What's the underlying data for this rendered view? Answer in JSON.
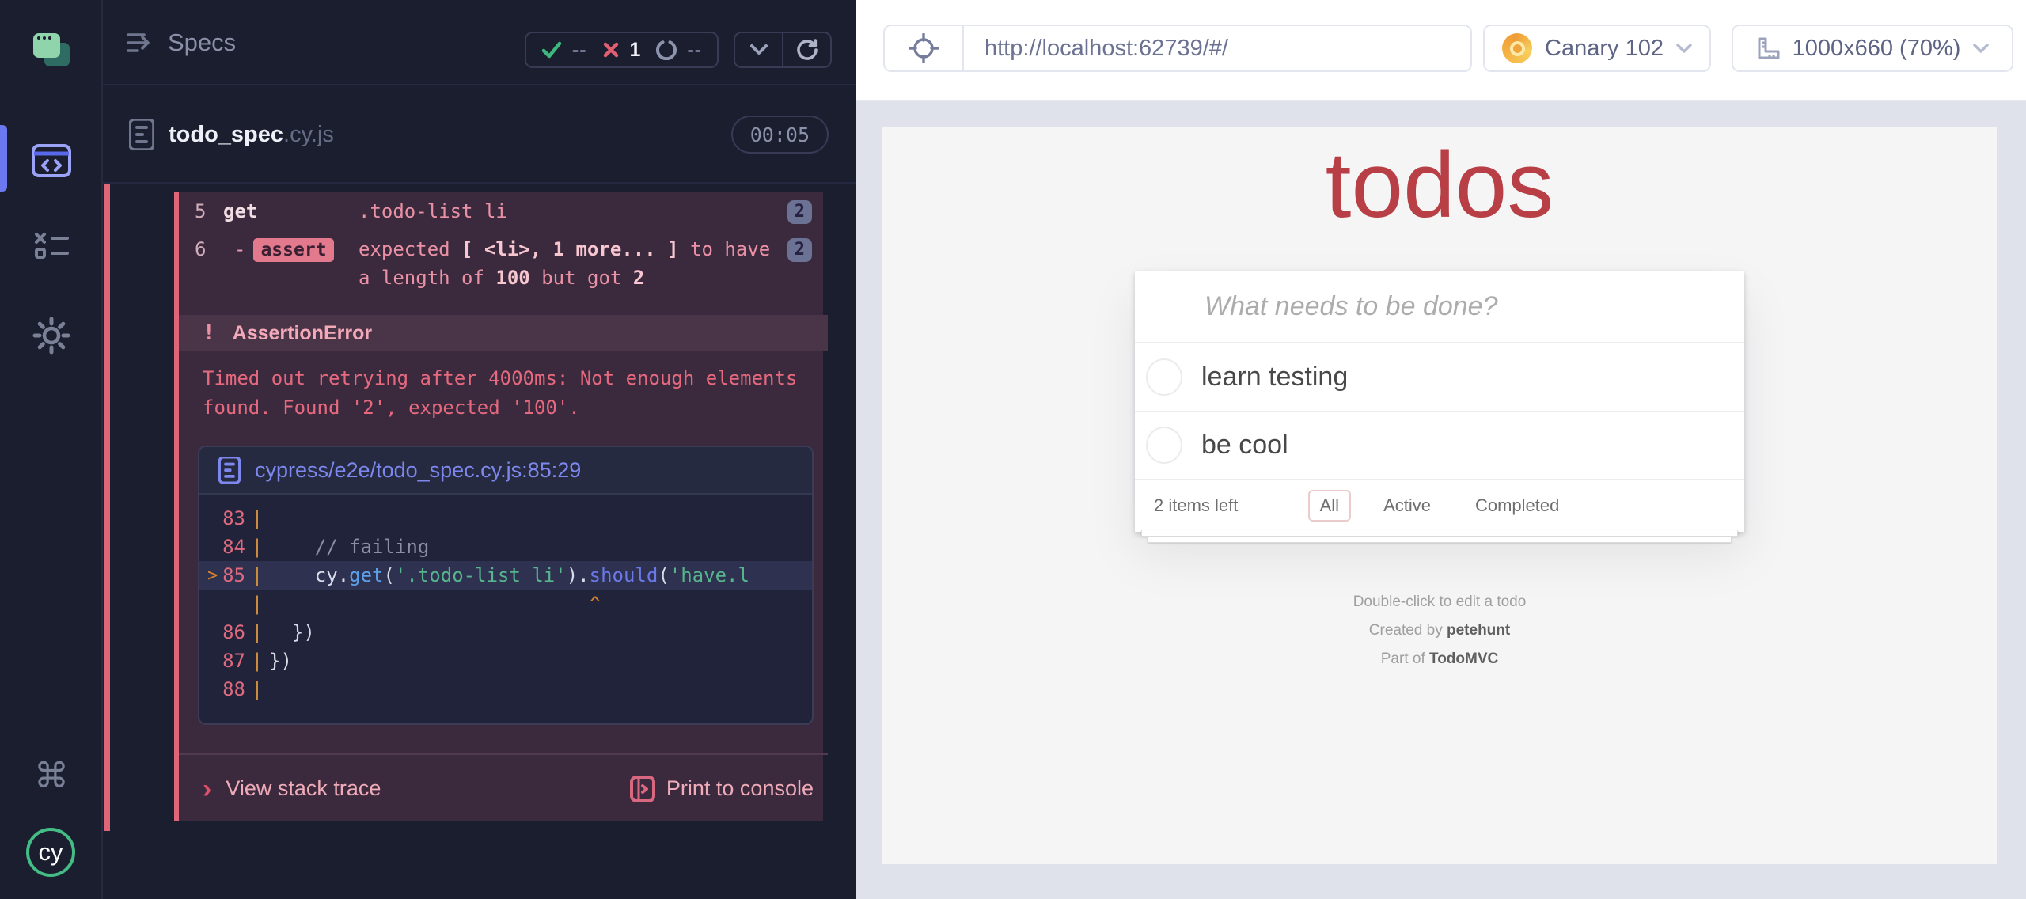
{
  "colors": {
    "accent_failed": "#e16b7f",
    "attempt_bg": "#3b2a3d",
    "panel_bg": "#1b1e2e",
    "pass_green": "#3eb77e",
    "fail_red": "#e25f71",
    "link_blue": "#7d88ef",
    "code_string_green": "#56b58c",
    "code_orange": "#d9832b",
    "canary_orange": "#f2a93f",
    "todo_title_red": "#b83f45",
    "brand_green": "#43bd85"
  },
  "sidebar": {
    "items": [
      {
        "id": "specs",
        "active": true
      },
      {
        "id": "runs",
        "active": false
      },
      {
        "id": "settings",
        "active": false
      }
    ],
    "command_glyph": "⌘",
    "cy_logo": "cy"
  },
  "reporter": {
    "title": "Specs",
    "stats": {
      "passed": "--",
      "failed": "1",
      "pending": "--"
    },
    "spec": {
      "name": "todo_spec",
      "ext": ".cy.js",
      "duration": "00:05"
    },
    "commands": [
      {
        "line": "5",
        "method": "get",
        "badge_method": false,
        "dash": "",
        "msg_lines": [
          [
            {
              "t": ".todo-list li"
            }
          ]
        ],
        "count": "2"
      },
      {
        "line": "6",
        "method": "assert",
        "badge_method": true,
        "dash": "-",
        "msg_lines": [
          [
            {
              "t": "expected "
            },
            {
              "t": "[ <li>, 1 more... ]",
              "b": 1
            },
            {
              "t": " to have"
            }
          ],
          [
            {
              "t": "a length of "
            },
            {
              "t": "100",
              "b": 1
            },
            {
              "t": " but got "
            },
            {
              "t": "2",
              "b": 1
            }
          ]
        ],
        "count": "2"
      }
    ],
    "error": {
      "bang": "!",
      "type": "AssertionError",
      "message": "Timed out retrying after 4000ms: Not enough elements found. Found '2', expected '100'."
    },
    "codeframe": {
      "file": "cypress/e2e/todo_spec.cy.js:85:29",
      "lines": [
        {
          "num": "83",
          "tokens": []
        },
        {
          "num": "84",
          "tokens": [
            {
              "t": "    // failing",
              "c": "com"
            }
          ]
        },
        {
          "num": "85",
          "hl": true,
          "tokens": [
            {
              "t": "    cy",
              "c": "pln"
            },
            {
              "t": ".",
              "c": "pln"
            },
            {
              "t": "get",
              "c": "fn"
            },
            {
              "t": "(",
              "c": "pln"
            },
            {
              "t": "'.todo-list li'",
              "c": "str"
            },
            {
              "t": ")",
              "c": "pln"
            },
            {
              "t": ".",
              "c": "pln"
            },
            {
              "t": "should",
              "c": "fn2"
            },
            {
              "t": "(",
              "c": "pln"
            },
            {
              "t": "'have.l",
              "c": "str"
            }
          ]
        },
        {
          "num": "",
          "tokens": [
            {
              "t": "                            ^",
              "c": "caret"
            }
          ]
        },
        {
          "num": "86",
          "tokens": [
            {
              "t": "  })",
              "c": "pln"
            }
          ]
        },
        {
          "num": "87",
          "tokens": [
            {
              "t": "})",
              "c": "pln"
            }
          ]
        },
        {
          "num": "88",
          "tokens": []
        }
      ]
    },
    "stack_chevron": "›",
    "stack_label": "View stack trace",
    "console_label": "Print to console"
  },
  "browser": {
    "url": "http://localhost:62739/#/",
    "name": "Canary 102",
    "viewport_label": "1000x660 (70%)"
  },
  "app": {
    "title": "todos",
    "placeholder": "What needs to be done?",
    "todos": [
      "learn testing",
      "be cool"
    ],
    "items_left": "2 items left",
    "filters": [
      "All",
      "Active",
      "Completed"
    ],
    "active_filter": "All",
    "footer_lines": [
      [
        {
          "t": "Double-click to edit a todo"
        }
      ],
      [
        {
          "t": "Created by "
        },
        {
          "t": "petehunt",
          "b": 1
        }
      ],
      [
        {
          "t": "Part of "
        },
        {
          "t": "TodoMVC",
          "b": 1
        }
      ]
    ]
  }
}
